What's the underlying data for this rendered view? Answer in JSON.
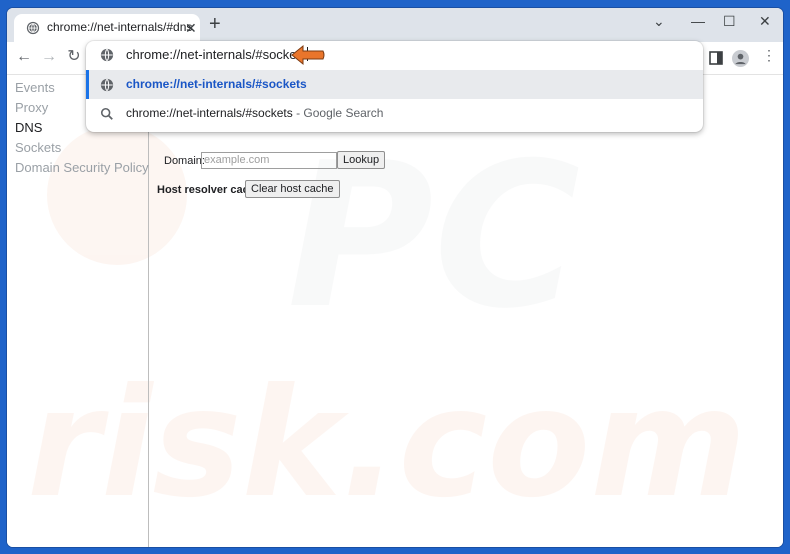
{
  "tab": {
    "title": "chrome://net-internals/#dns"
  },
  "window_controls": {
    "minimize": "—",
    "maximize": "☐",
    "close": "✕",
    "tab_search": "⌄"
  },
  "omnibox": {
    "value": "chrome://net-internals/#sockets",
    "suggestions": [
      {
        "text": "chrome://net-internals/#sockets",
        "desc": ""
      },
      {
        "text": "chrome://net-internals/#sockets",
        "desc": " - Google Search"
      }
    ]
  },
  "sidebar": {
    "items": [
      {
        "label": "Events"
      },
      {
        "label": "Proxy"
      },
      {
        "label": "DNS"
      },
      {
        "label": "Sockets"
      },
      {
        "label": "Domain Security Policy"
      }
    ]
  },
  "dns": {
    "domain_label": "Domain:",
    "domain_placeholder": "example.com",
    "lookup_button": "Lookup",
    "cache_label": "Host resolver cache",
    "clear_button": "Clear host cache"
  },
  "colors": {
    "accent": "#1a73e8",
    "annotation_arrow": "#e9752b",
    "selected_suggestion_text": "#1a56c6"
  }
}
